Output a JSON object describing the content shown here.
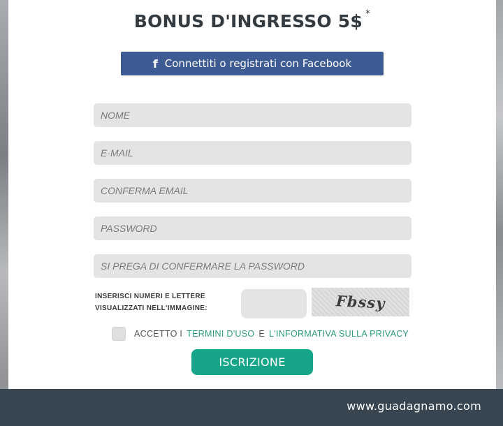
{
  "header": {
    "title": "BONUS D'INGRESSO 5$",
    "asterisk": "*"
  },
  "facebook": {
    "icon": "facebook-f-icon",
    "icon_glyph": "f",
    "label": "Connettiti o registrati con Facebook",
    "color": "#3f5b94"
  },
  "form": {
    "name_placeholder": "NOME",
    "email_placeholder": "E-MAIL",
    "confirm_email_placeholder": "CONFERMA EMAIL",
    "password_placeholder": "PASSWORD",
    "confirm_password_placeholder": "SI PREGA DI CONFERMARE LA PASSWORD",
    "captcha_label_line1": "INSERISCI NUMERI E LETTERE",
    "captcha_label_line2": "VISUALIZZATI NELL'IMMAGINE:",
    "captcha_text": "Fbssy",
    "accept_prefix": "ACCETTO I",
    "terms_link": "TERMINI D'USO",
    "and_word": "E",
    "privacy_link": "L'INFORMATIVA SULLA PRIVACY",
    "submit_label": "ISCRIZIONE",
    "submit_color": "#17a589",
    "link_color": "#2a9d7b"
  },
  "footer": {
    "url": "www.guadagnamo.com",
    "color": "#374651"
  }
}
